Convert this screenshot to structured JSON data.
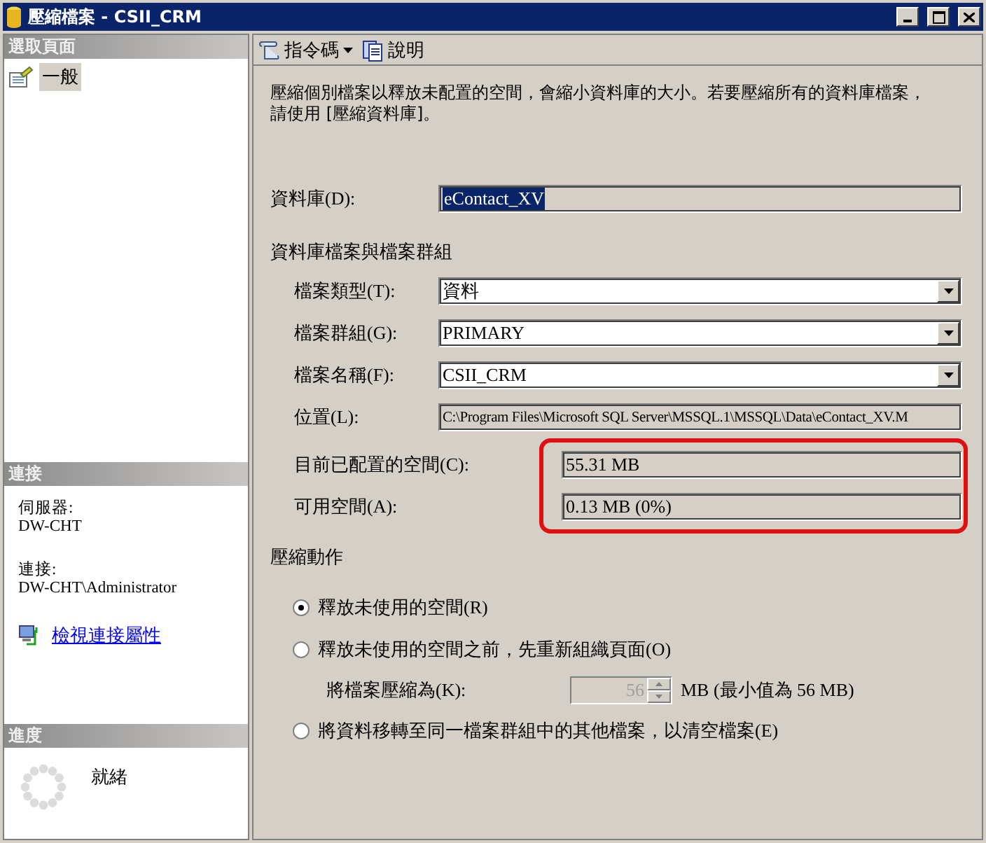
{
  "window": {
    "title": "壓縮檔案 - CSII_CRM"
  },
  "sidebar": {
    "pages_header": "選取頁面",
    "pages": [
      {
        "label": "一般",
        "selected": true
      }
    ],
    "connection": {
      "header": "連接",
      "server_label": "伺服器:",
      "server": "DW-CHT",
      "user_label": "連接:",
      "user": "DW-CHT\\Administrator",
      "link": "檢視連接屬性"
    },
    "progress": {
      "header": "進度",
      "status": "就緒"
    }
  },
  "toolbar": [
    {
      "label": "指令碼",
      "kind": "script"
    },
    {
      "label": "說明",
      "kind": "help"
    }
  ],
  "description": "壓縮個別檔案以釋放未配置的空間，會縮小資料庫的大小。若要壓縮所有的資料庫檔案，請使用 [壓縮資料庫]。",
  "database": {
    "label": "資料庫(D):",
    "value": "eContact_XV",
    "text_selected": true
  },
  "files_group": {
    "title": "資料庫檔案與檔案群組",
    "fields": [
      {
        "label": "檔案類型(T):",
        "value": "資料",
        "kind": "dropdown"
      },
      {
        "label": "檔案群組(G):",
        "value": "PRIMARY",
        "kind": "dropdown"
      },
      {
        "label": "檔案名稱(F):",
        "value": "CSII_CRM",
        "kind": "dropdown"
      },
      {
        "label": "位置(L):",
        "value": "C:\\Program Files\\Microsoft SQL Server\\MSSQL.1\\MSSQL\\Data\\eContact_XV.M",
        "kind": "readonly"
      }
    ]
  },
  "space": {
    "highlighted": true,
    "rows": [
      {
        "label": "目前已配置的空間(C):",
        "value": "55.31 MB"
      },
      {
        "label": "可用空間(A):",
        "value": "0.13 MB (0%)"
      }
    ]
  },
  "shrink_action": {
    "title": "壓縮動作",
    "options": [
      {
        "label": "釋放未使用的空間(R)",
        "selected": true
      },
      {
        "label": "釋放未使用的空間之前，先重新組織頁面(O)",
        "selected": false
      },
      {
        "label": "將資料移轉至同一檔案群組中的其他檔案，以清空檔案(E)",
        "selected": false
      }
    ],
    "shrink_to": {
      "label": "將檔案壓縮為(K):",
      "value": "56",
      "unit": "MB (最小值為 56 MB)",
      "disabled": true
    }
  }
}
